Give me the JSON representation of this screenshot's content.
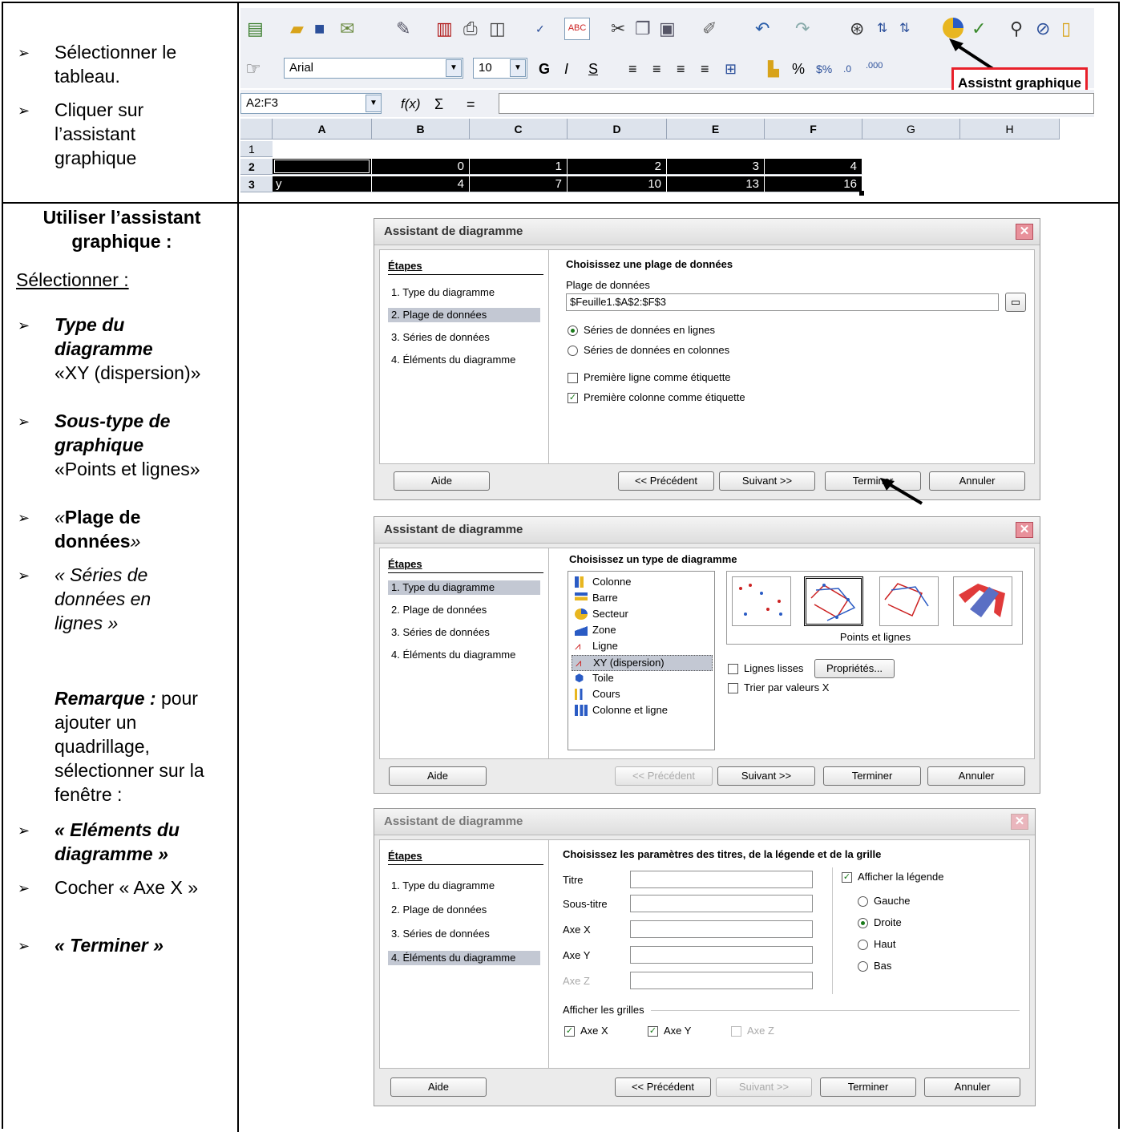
{
  "left": {
    "bullet_glyph": "➢",
    "select_table": "Sélectionner le tableau.",
    "click_assistant": "Cliquer sur l’assistant graphique",
    "use_assistant_title": "Utiliser l’assistant graphique :",
    "select_label": "Sélectionner :",
    "chart_type_label": "Type du diagramme",
    "chart_type_value": "«XY (dispersion)»",
    "subtype_label": "Sous-type de graphique",
    "subtype_value": "«Points et lignes»",
    "data_range_quote_open": "«",
    "data_range_label": "Plage de données",
    "data_range_quote_close": "»",
    "series_rows": "« Séries de données en lignes »",
    "remark_label": "Remarque :",
    "remark_text": "pour ajouter un quadrillage, sélectionner sur la fenêtre :",
    "elements_label": "« Eléments du diagramme »",
    "check_axis_x": "Cocher « Axe X »",
    "finish_label": "« Terminer »"
  },
  "spreadsheet": {
    "font_name": "Arial",
    "font_size": "10",
    "bold_glyph": "G",
    "italic_glyph": "I",
    "underline_glyph": "S",
    "percent_glyph": "%",
    "name_box": "A2:F3",
    "fx_label": "f(x)",
    "sum_glyph": "Σ",
    "eq_glyph": "=",
    "tooltip": "Assistnt graphique",
    "columns": [
      "A",
      "B",
      "C",
      "D",
      "E",
      "F",
      "G",
      "H"
    ],
    "rows": [
      "1",
      "2",
      "3"
    ],
    "row2": [
      "",
      "0",
      "1",
      "2",
      "3",
      "4"
    ],
    "row3": [
      "y",
      "4",
      "7",
      "10",
      "13",
      "16"
    ]
  },
  "dialog1": {
    "title": "Assistant de diagramme",
    "steps_heading": "Étapes",
    "steps": [
      "1. Type du diagramme",
      "2. Plage de données",
      "3. Séries de données",
      "4. Éléments du diagramme"
    ],
    "heading": "Choisissez une plage de données",
    "range_label": "Plage de données",
    "range_value": "$Feuille1.$A$2:$F$3",
    "radio_rows": "Séries de données en lignes",
    "radio_cols": "Séries de données en colonnes",
    "first_row_label": "Première ligne comme étiquette",
    "first_col_label": "Première colonne comme étiquette",
    "btn_help": "Aide",
    "btn_prev": "<< Précédent",
    "btn_next": "Suivant >>",
    "btn_finish": "Terminer",
    "btn_cancel": "Annuler"
  },
  "dialog2": {
    "title": "Assistant de diagramme",
    "steps_heading": "Étapes",
    "steps": [
      "1. Type du diagramme",
      "2. Plage de données",
      "3. Séries de données",
      "4. Éléments du diagramme"
    ],
    "heading": "Choisissez un type de diagramme",
    "types": [
      "Colonne",
      "Barre",
      "Secteur",
      "Zone",
      "Ligne",
      "XY (dispersion)",
      "Toile",
      "Cours",
      "Colonne et ligne"
    ],
    "subtype_caption": "Points et lignes",
    "smooth_label": "Lignes lisses",
    "props_btn": "Propriétés...",
    "sort_label": "Trier par valeurs X",
    "btn_help": "Aide",
    "btn_prev": "<< Précédent",
    "btn_next": "Suivant >>",
    "btn_finish": "Terminer",
    "btn_cancel": "Annuler"
  },
  "dialog3": {
    "title": "Assistant de diagramme",
    "steps_heading": "Étapes",
    "steps": [
      "1. Type du diagramme",
      "2. Plage de données",
      "3. Séries de données",
      "4. Éléments du diagramme"
    ],
    "heading": "Choisissez les paramètres des titres, de la légende et de la grille",
    "title_label": "Titre",
    "subtitle_label": "Sous-titre",
    "axis_x_label": "Axe X",
    "axis_y_label": "Axe Y",
    "axis_z_label": "Axe Z",
    "show_legend": "Afficher la légende",
    "legend_left": "Gauche",
    "legend_right": "Droite",
    "legend_top": "Haut",
    "legend_bottom": "Bas",
    "grids_label": "Afficher les grilles",
    "grid_x": "Axe X",
    "grid_y": "Axe Y",
    "grid_z": "Axe Z",
    "btn_help": "Aide",
    "btn_prev": "<< Précédent",
    "btn_next": "Suivant >>",
    "btn_finish": "Terminer",
    "btn_cancel": "Annuler"
  },
  "colors": {
    "accent_red": "#e8202a",
    "selection": "#c3c8d3",
    "check": "#1a7a1a"
  }
}
